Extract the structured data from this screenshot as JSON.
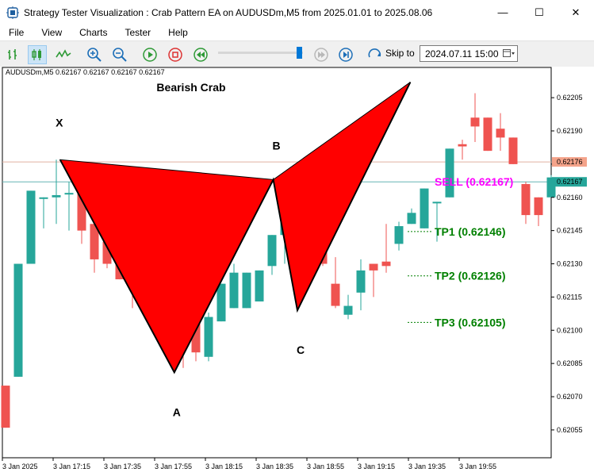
{
  "window": {
    "title": "Strategy Tester Visualization : Crab Pattern EA on AUDUSDm,M5 from 2025.01.01 to 2025.08.06",
    "minimize": "—",
    "maximize": "☐",
    "close": "✕"
  },
  "menu": [
    "File",
    "View",
    "Charts",
    "Tester",
    "Help"
  ],
  "toolbar": {
    "icons": [
      "bar-chart-icon",
      "candlestick-icon",
      "line-chart-icon",
      "zoom-in-icon",
      "zoom-out-icon",
      "play-icon",
      "stop-icon",
      "rewind-icon",
      "skip-disabled-icon",
      "forward-icon",
      "skip-to-icon"
    ],
    "skip_to_label": "Skip to",
    "skip_to_value": "2024.07.11 15:00",
    "speed_fraction": 0.93
  },
  "colors": {
    "bull": "#26a69a",
    "bear": "#ef5350",
    "pattern_fill": "#ff0000",
    "sell": "#ff00ff",
    "tp": "#008000",
    "price_line": "#d0a0a0",
    "ask_line": "#26a69a"
  },
  "chart_data": {
    "type": "candlestick",
    "symbol_info": "AUDUSDm,M5  0.62167 0.62167 0.62167 0.62167",
    "pattern_title": "Bearish Crab",
    "ylim": [
      0.62041,
      0.62214
    ],
    "y_ticks": [
      "0.62205",
      "0.62190",
      "0.62175",
      "0.62160",
      "0.62145",
      "0.62130",
      "0.62115",
      "0.62100",
      "0.62085",
      "0.62070",
      "0.62055"
    ],
    "y_tick_values": [
      0.62205,
      0.6219,
      0.62175,
      0.6216,
      0.62145,
      0.6213,
      0.62115,
      0.621,
      0.62085,
      0.6207,
      0.62055
    ],
    "x_ticks": [
      "3 Jan 2025",
      "3 Jan 17:15",
      "3 Jan 17:35",
      "3 Jan 17:55",
      "3 Jan 18:15",
      "3 Jan 18:35",
      "3 Jan 18:55",
      "3 Jan 19:15",
      "3 Jan 19:35",
      "3 Jan 19:55"
    ],
    "x_tick_candle_index": [
      0,
      4,
      8,
      12,
      16,
      20,
      24,
      28,
      32,
      36
    ],
    "candles": [
      [
        0.62075,
        0.62075,
        0.62056,
        0.62056
      ],
      [
        0.62079,
        0.6213,
        0.62079,
        0.6213
      ],
      [
        0.6213,
        0.62163,
        0.6213,
        0.62163
      ],
      [
        0.6216,
        0.6216,
        0.62146,
        0.6216
      ],
      [
        0.6216,
        0.62177,
        0.62148,
        0.62161
      ],
      [
        0.62162,
        0.62167,
        0.62145,
        0.62162
      ],
      [
        0.62165,
        0.62167,
        0.62139,
        0.62145
      ],
      [
        0.62148,
        0.62148,
        0.62126,
        0.62132
      ],
      [
        0.6214,
        0.6214,
        0.62128,
        0.6213
      ],
      [
        0.62132,
        0.62133,
        0.62123,
        0.62123
      ],
      [
        0.62134,
        0.6214,
        0.6211,
        0.62121
      ],
      [
        0.62121,
        0.6213,
        0.6211,
        0.62117
      ],
      [
        0.62127,
        0.62127,
        0.62103,
        0.6211
      ],
      [
        0.62112,
        0.6213,
        0.62112,
        0.62118
      ],
      [
        0.62117,
        0.62117,
        0.62083,
        0.6211
      ],
      [
        0.6211,
        0.6211,
        0.62086,
        0.6209
      ],
      [
        0.62088,
        0.62108,
        0.62086,
        0.62106
      ],
      [
        0.62104,
        0.62121,
        0.62104,
        0.62121
      ],
      [
        0.6211,
        0.6213,
        0.6211,
        0.62126
      ],
      [
        0.6211,
        0.62126,
        0.6211,
        0.62126
      ],
      [
        0.62113,
        0.62127,
        0.62113,
        0.62127
      ],
      [
        0.62129,
        0.62143,
        0.62125,
        0.62143
      ],
      [
        0.62143,
        0.62148,
        0.6213,
        0.6215
      ],
      [
        0.62143,
        0.62148,
        0.6214,
        0.62148
      ],
      [
        0.6215,
        0.6215,
        0.6214,
        0.6214
      ],
      [
        0.6215,
        0.6215,
        0.62129,
        0.6213
      ],
      [
        0.62121,
        0.62133,
        0.6211,
        0.62111
      ],
      [
        0.62107,
        0.62116,
        0.62105,
        0.62111
      ],
      [
        0.62117,
        0.62132,
        0.62109,
        0.62127
      ],
      [
        0.6213,
        0.6213,
        0.62115,
        0.62127
      ],
      [
        0.62131,
        0.62148,
        0.62126,
        0.62129
      ],
      [
        0.62139,
        0.62149,
        0.62136,
        0.62147
      ],
      [
        0.62148,
        0.62155,
        0.62148,
        0.62153
      ],
      [
        0.62146,
        0.62164,
        0.62146,
        0.62164
      ],
      [
        0.62158,
        0.62158,
        0.6214,
        0.62158
      ],
      [
        0.6216,
        0.62182,
        0.6216,
        0.62182
      ],
      [
        0.62184,
        0.62186,
        0.62177,
        0.62183
      ],
      [
        0.62196,
        0.62207,
        0.62185,
        0.62192
      ],
      [
        0.62196,
        0.62196,
        0.62181,
        0.62181
      ],
      [
        0.62191,
        0.62198,
        0.62181,
        0.62187
      ],
      [
        0.62187,
        0.62187,
        0.62175,
        0.62175
      ],
      [
        0.62166,
        0.62167,
        0.62148,
        0.62152
      ],
      [
        0.6216,
        0.6216,
        0.62147,
        0.62152
      ],
      [
        0.6216,
        0.6217,
        0.6216,
        0.62169
      ]
    ],
    "pattern": {
      "X": {
        "candle": 4.3,
        "price": 0.62177
      },
      "A": {
        "candle": 13.3,
        "price": 0.62081
      },
      "B": {
        "candle": 21.1,
        "price": 0.62168
      },
      "C": {
        "candle": 23.0,
        "price": 0.62109
      },
      "D": {
        "candle": 31.9,
        "price": 0.62212
      },
      "labels": {
        "X": "X",
        "A": "A",
        "B": "B",
        "C": "C"
      }
    },
    "bid_line": {
      "price": 0.62176,
      "label": "0.62176"
    },
    "ask_line": {
      "price": 0.62167,
      "label": "0.62167"
    },
    "sell": {
      "text": "SELL (0.62167)",
      "price": 0.62167
    },
    "tps": [
      {
        "text": "TP1 (0.62146)",
        "price": 0.62146
      },
      {
        "text": "TP2 (0.62126)",
        "price": 0.62126
      },
      {
        "text": "TP3 (0.62105)",
        "price": 0.62105
      }
    ]
  }
}
